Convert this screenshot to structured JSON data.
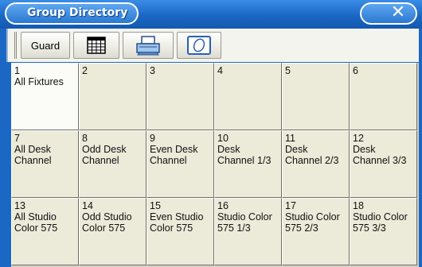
{
  "window": {
    "title": "Group Directory",
    "close_icon": "close-icon"
  },
  "toolbar": {
    "guard_label": "Guard",
    "buttons": [
      "sheet-view-icon",
      "printer-icon",
      "options-icon"
    ]
  },
  "groups": [
    {
      "number": "1",
      "label": "All Fixtures"
    },
    {
      "number": "2",
      "label": ""
    },
    {
      "number": "3",
      "label": ""
    },
    {
      "number": "4",
      "label": ""
    },
    {
      "number": "5",
      "label": ""
    },
    {
      "number": "6",
      "label": ""
    },
    {
      "number": "7",
      "label": "All Desk\nChannel"
    },
    {
      "number": "8",
      "label": "Odd Desk\nChannel"
    },
    {
      "number": "9",
      "label": "Even Desk\nChannel"
    },
    {
      "number": "10",
      "label": "Desk\nChannel 1/3"
    },
    {
      "number": "11",
      "label": "Desk\nChannel 2/3"
    },
    {
      "number": "12",
      "label": "Desk\nChannel 3/3"
    },
    {
      "number": "13",
      "label": "All Studio\nColor 575"
    },
    {
      "number": "14",
      "label": "Odd Studio\nColor 575"
    },
    {
      "number": "15",
      "label": "Even Studio\nColor 575"
    },
    {
      "number": "16",
      "label": "Studio Color\n575 1/3"
    },
    {
      "number": "17",
      "label": "Studio Color\n575 2/3"
    },
    {
      "number": "18",
      "label": "Studio Color\n575 3/3"
    }
  ]
}
